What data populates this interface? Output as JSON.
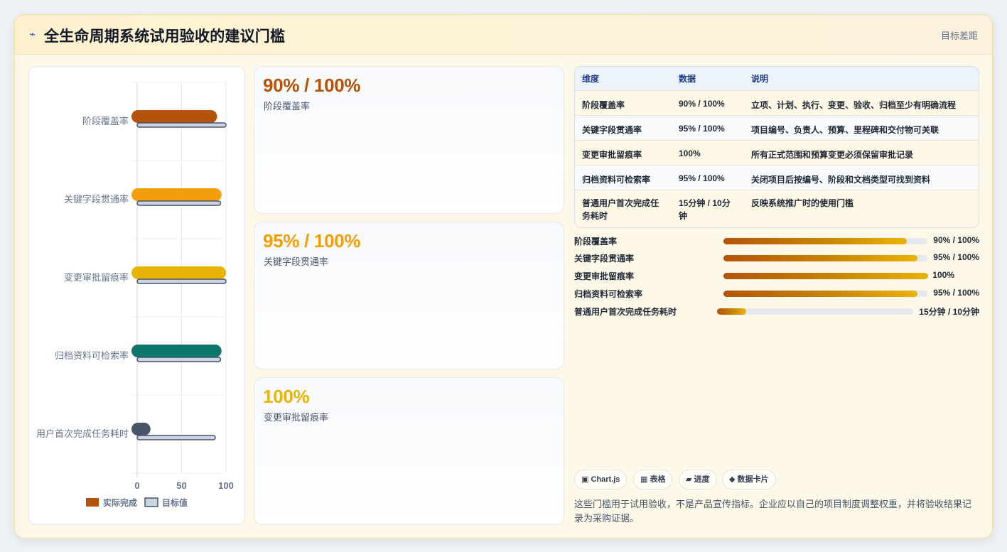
{
  "header": {
    "icon": "bolt-icon",
    "title": "全生命周期系统试用验收的建议门槛",
    "right_label": "目标差距"
  },
  "chart_data": {
    "type": "bar",
    "orientation": "horizontal",
    "categories": [
      "阶段覆盖率",
      "关键字段贯通率",
      "变更审批留痕率",
      "归档资料可检索率",
      "用户首次完成任务耗时"
    ],
    "series": [
      {
        "name": "实际完成",
        "values": [
          90,
          95,
          100,
          95,
          15
        ],
        "colors": [
          "#b45309",
          "#f59e0b",
          "#eab308",
          "#0f766e",
          "#475569"
        ]
      },
      {
        "name": "目标值",
        "values": [
          100,
          100,
          100,
          100,
          100
        ],
        "color": "#cbd5e1"
      }
    ],
    "xlim": [
      0,
      100
    ],
    "xticks": [
      "0",
      "50",
      "100"
    ],
    "grid": true,
    "legend_position": "bottom"
  },
  "kpis": [
    {
      "value": "90% / 100%",
      "label": "阶段覆盖率",
      "color": "#b45309"
    },
    {
      "value": "95% / 100%",
      "label": "关键字段贯通率",
      "color": "#f59e0b"
    },
    {
      "value": "100%",
      "label": "变更审批留痕率",
      "color": "#eab308"
    }
  ],
  "table": {
    "headers": [
      "维度",
      "数据",
      "说明"
    ],
    "rows": [
      [
        "阶段覆盖率",
        "90% / 100%",
        "立项、计划、执行、变更、验收、归档至少有明确流程"
      ],
      [
        "关键字段贯通率",
        "95% / 100%",
        "项目编号、负责人、预算、里程碑和交付物可关联"
      ],
      [
        "变更审批留痕率",
        "100%",
        "所有正式范围和预算变更必须保留审批记录"
      ],
      [
        "归档资料可检索率",
        "95% / 100%",
        "关闭项目后按编号、阶段和文档类型可找到资料"
      ],
      [
        "普通用户首次完成任务耗时",
        "15分钟 / 10分钟",
        "反映系统推广时的使用门槛"
      ]
    ]
  },
  "progress": [
    {
      "label": "阶段覆盖率",
      "value": "90% / 100%",
      "fraction": 0.9
    },
    {
      "label": "关键字段贯通率",
      "value": "95% / 100%",
      "fraction": 0.95
    },
    {
      "label": "变更审批留痕率",
      "value": "100%",
      "fraction": 1.0
    },
    {
      "label": "归档资料可检索率",
      "value": "95% / 100%",
      "fraction": 0.95
    },
    {
      "label": "普通用户首次完成任务耗时",
      "value": "15分钟 / 10分钟",
      "fraction": 0.15
    }
  ],
  "chips": [
    {
      "icon": "chart-icon",
      "glyph": "▣",
      "label": "Chart.js"
    },
    {
      "icon": "table-icon",
      "glyph": "▦",
      "label": "表格"
    },
    {
      "icon": "progress-icon",
      "glyph": "▰",
      "label": "进度"
    },
    {
      "icon": "diamond-icon",
      "glyph": "◆",
      "label": "数据卡片"
    }
  ],
  "note": "这些门槛用于试用验收，不是产品宣传指标。企业应以自己的项目制度调整权重，并将验收结果记录为采购证据。"
}
